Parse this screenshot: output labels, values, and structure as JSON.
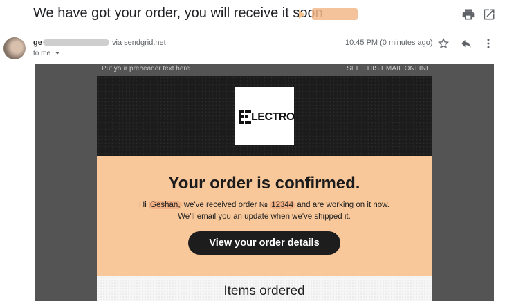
{
  "email": {
    "subject": "We have got your order, you will receive it soon",
    "sender_name": "ge",
    "via_word": "via",
    "via_domain": "sendgrid.net",
    "to_me": "to me",
    "timestamp": "10:45 PM (0 minutes ago)"
  },
  "icons": {
    "print": "print-icon",
    "open_new_window": "open-in-new-window-icon",
    "star": "star-icon",
    "reply": "reply-icon",
    "more": "more-vertical-icon",
    "dropdown": "chevron-down-icon"
  },
  "body": {
    "preheader": "Put your preheader text here",
    "see_online": "SEE THIS EMAIL ONLINE",
    "logo_text": "LECTRO",
    "confirm_title": "Your order is confirmed.",
    "greeting_prefix": "Hi ",
    "customer_name": "Geshan,",
    "received_text": " we've received order № ",
    "order_number": "12344",
    "working_text": " and are working on it now.",
    "update_text": "We'll email you an update when we've shipped it.",
    "cta_label": "View your order details",
    "items_title": "Items ordered"
  },
  "colors": {
    "hero_bg": "#1c1c1c",
    "confirm_bg": "#f9c89a",
    "button_bg": "#1d1d1d",
    "outer_bg": "#545454",
    "label_tag": "#f2b98a"
  }
}
